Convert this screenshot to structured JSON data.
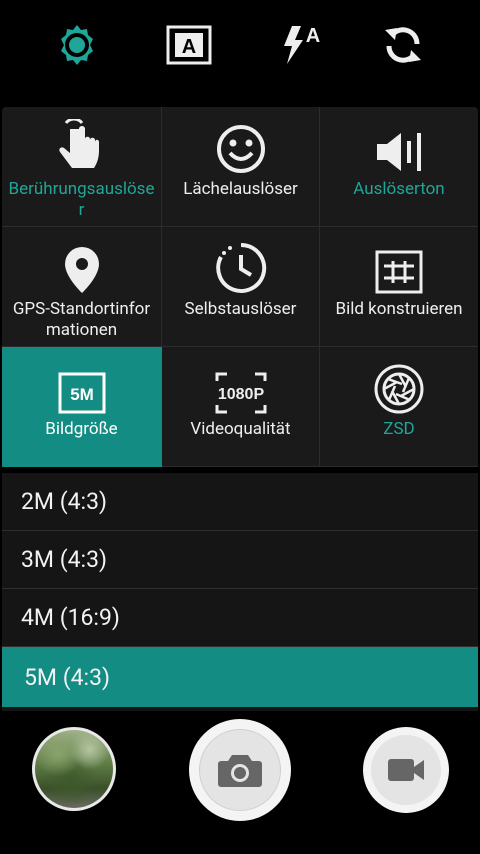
{
  "top_bar": {
    "icons": [
      "settings-gear-icon",
      "auto-scene-icon",
      "flash-auto-icon",
      "switch-camera-icon"
    ],
    "flash_mode_letter": "A",
    "scene_mode_letter": "A",
    "accent": "#1fa699"
  },
  "settings": [
    {
      "label": "Berührungsauslöse\nr",
      "icon": "touch-hand-icon",
      "highlight": true
    },
    {
      "label": "Lächelauslöser",
      "icon": "smile-icon",
      "highlight": false
    },
    {
      "label": "Auslöserton",
      "icon": "speaker-icon",
      "highlight": true
    },
    {
      "label": "GPS-Standortinfor\nmationen",
      "icon": "location-pin-icon",
      "highlight": false
    },
    {
      "label": "Selbstauslöser",
      "icon": "timer-clock-icon",
      "highlight": false
    },
    {
      "label": "Bild konstruieren",
      "icon": "grid-frame-icon",
      "highlight": false
    },
    {
      "label": "Bildgröße",
      "icon": "picture-size-icon",
      "badge": "5M",
      "active": true
    },
    {
      "label": "Videoqualität",
      "icon": "video-quality-icon",
      "badge": "1080P",
      "active": false
    },
    {
      "label": "ZSD",
      "icon": "aperture-icon",
      "highlight": true
    }
  ],
  "size_options": {
    "items": [
      "2M (4:3)",
      "3M (4:3)",
      "4M (16:9)",
      "5M (4:3)"
    ],
    "selected": "5M (4:3)"
  },
  "bottom": {
    "thumbnail": "gallery-thumbnail",
    "shutter": "camera-icon",
    "video": "video-record-icon"
  },
  "colors": {
    "active_bg": "#138c83",
    "teal_text": "#1fa699",
    "background": "#000000"
  }
}
